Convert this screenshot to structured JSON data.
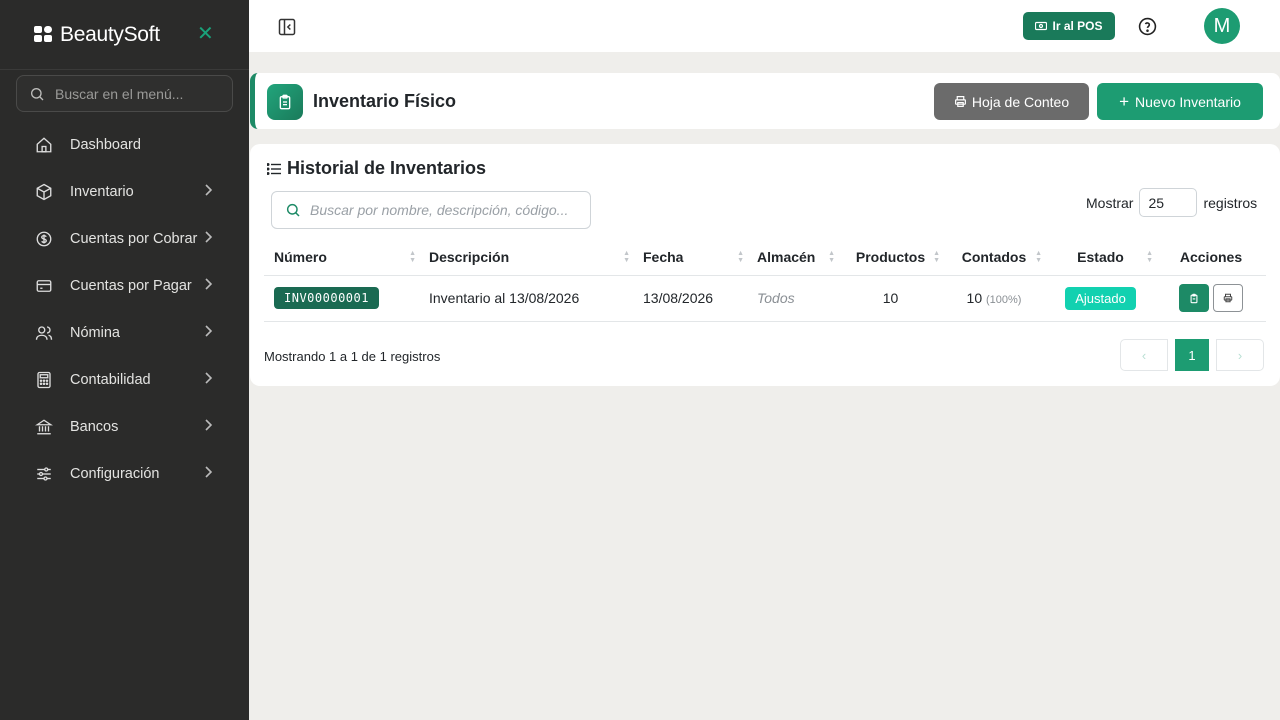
{
  "app": {
    "brand": "BeautySoft"
  },
  "sidebar": {
    "search_placeholder": "Buscar en el menú...",
    "items": [
      {
        "label": "Dashboard",
        "icon": "home-icon",
        "has_children": false
      },
      {
        "label": "Inventario",
        "icon": "box-icon",
        "has_children": true
      },
      {
        "label": "Cuentas por Cobrar",
        "icon": "dollar-circle-icon",
        "has_children": true
      },
      {
        "label": "Cuentas por Pagar",
        "icon": "credit-card-icon",
        "has_children": true
      },
      {
        "label": "Nómina",
        "icon": "users-icon",
        "has_children": true
      },
      {
        "label": "Contabilidad",
        "icon": "calculator-icon",
        "has_children": true
      },
      {
        "label": "Bancos",
        "icon": "bank-icon",
        "has_children": true
      },
      {
        "label": "Configuración",
        "icon": "sliders-icon",
        "has_children": true
      }
    ]
  },
  "topbar": {
    "pos_label": "Ir al POS",
    "avatar_initial": "M"
  },
  "page": {
    "title": "Inventario Físico",
    "count_sheet_label": "Hoja de Conteo",
    "new_inventory_label": "Nuevo Inventario"
  },
  "history": {
    "title": "Historial de Inventarios",
    "search_placeholder": "Buscar por nombre, descripción, código...",
    "show_label": "Mostrar",
    "page_size": "25",
    "records_label": "registros",
    "columns": [
      "Número",
      "Descripción",
      "Fecha",
      "Almacén",
      "Productos",
      "Contados",
      "Estado",
      "Acciones"
    ],
    "rows": [
      {
        "number": "INV00000001",
        "description": "Inventario al 13/08/2026",
        "date": "13/08/2026",
        "warehouse": "Todos",
        "products": "10",
        "counted": "10",
        "counted_pct": "(100%)",
        "status": "Ajustado"
      }
    ],
    "footer": "Mostrando 1 a 1 de 1 registros",
    "pagination": {
      "prev": "‹",
      "current": "1",
      "next": "›"
    }
  },
  "colors": {
    "primary": "#1d9c72",
    "sidebar_bg": "#2b2b2a",
    "status_adjusted": "#12d1b0"
  }
}
